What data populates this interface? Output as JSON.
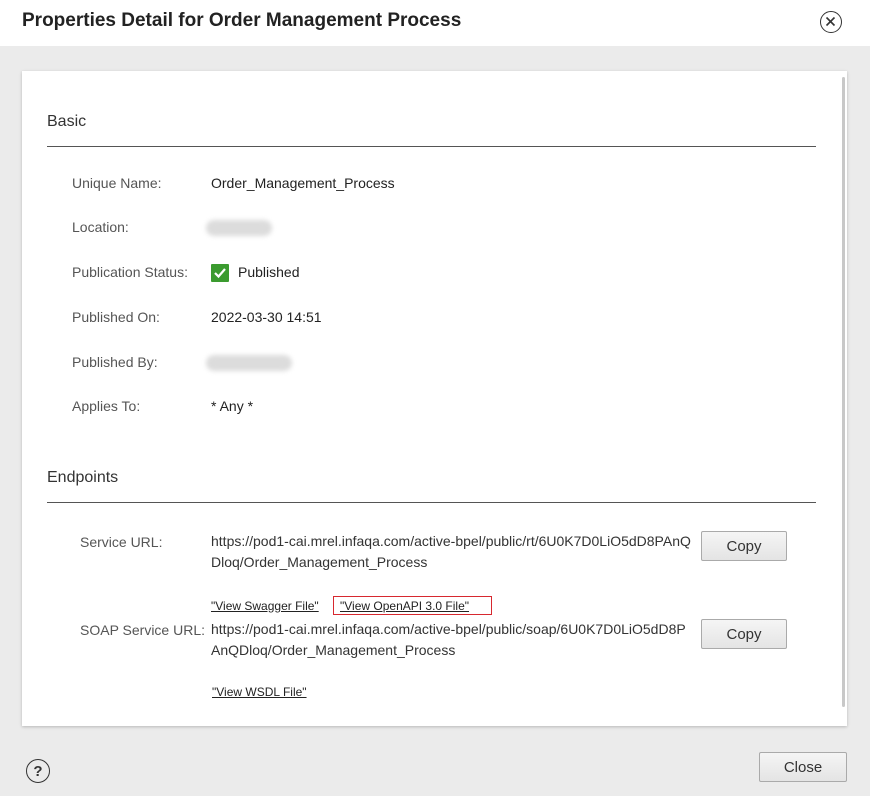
{
  "dialog": {
    "title": "Properties Detail for Order Management Process",
    "close_button_label": "Close",
    "close_icon": "circle-x-icon",
    "help_icon": "help-circle-icon",
    "help_glyph": "?"
  },
  "basic": {
    "title": "Basic",
    "fields": {
      "unique_name": {
        "label": "Unique Name:",
        "value": "Order_Management_Process"
      },
      "location": {
        "label": "Location:",
        "value": ""
      },
      "publication_status": {
        "label": "Publication Status:",
        "value": "Published",
        "icon": "checkbox-checked-icon",
        "color": "#3b9b2f"
      },
      "published_on": {
        "label": "Published On:",
        "value": "2022-03-30 14:51"
      },
      "published_by": {
        "label": "Published By:",
        "value": ""
      },
      "applies_to": {
        "label": "Applies To:",
        "value": "* Any *"
      }
    }
  },
  "endpoints": {
    "title": "Endpoints",
    "service": {
      "label": "Service URL:",
      "url": "https://pod1-cai.mrel.infaqa.com/active-bpel/public/rt/6U0K7D0LiO5dD8PAnQDloq/Order_Management_Process",
      "copy_label": "Copy",
      "swagger_link": "\"View Swagger File\"",
      "openapi_link": "\"View OpenAPI 3.0 File\"",
      "highlight_color": "#d7282f"
    },
    "soap": {
      "label": "SOAP Service URL:",
      "url": "https://pod1-cai.mrel.infaqa.com/active-bpel/public/soap/6U0K7D0LiO5dD8PAnQDloq/Order_Management_Process",
      "copy_label": "Copy",
      "wsdl_link": "\"View WSDL File\""
    }
  }
}
